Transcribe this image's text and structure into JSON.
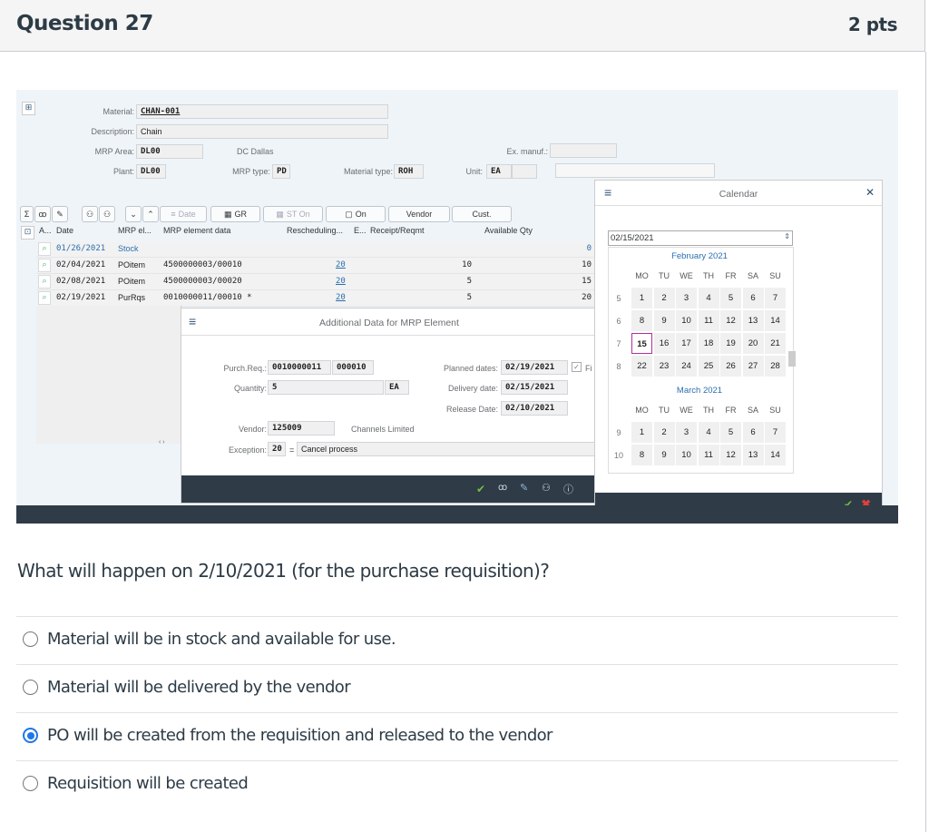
{
  "question": {
    "title": "Question 27",
    "points": "2 pts",
    "text": "What will happen on 2/10/2021 (for the purchase requisition)?",
    "answers": [
      {
        "label": "Material will be in stock and available for use.",
        "selected": false
      },
      {
        "label": "Material will be delivered by the vendor",
        "selected": false
      },
      {
        "label": "PO will be created from the requisition and released to the vendor",
        "selected": true
      },
      {
        "label": "Requisition will be created",
        "selected": false
      }
    ]
  },
  "sap": {
    "header": {
      "material_label": "Material:",
      "material": "CHAN-001",
      "description_label": "Description:",
      "description": "Chain",
      "mrp_area_label": "MRP Area:",
      "mrp_area": "DL00",
      "mrp_area_text": "DC Dallas",
      "plant_label": "Plant:",
      "plant": "DL00",
      "mrp_type_label": "MRP type:",
      "mrp_type": "PD",
      "material_type_label": "Material type:",
      "material_type": "ROH",
      "unit_label": "Unit:",
      "unit": "EA",
      "ex_manuf_label": "Ex. manuf.:"
    },
    "toolbar": {
      "date": "Date",
      "gr": "GR",
      "st_on": "ST On",
      "on": "On",
      "vendor": "Vendor",
      "cust": "Cust."
    },
    "columns": [
      "A...",
      "Date",
      "MRP el...",
      "MRP element data",
      "Rescheduling...",
      "E...",
      "Receipt/Reqmt",
      "Available Qty"
    ],
    "rows": [
      {
        "date": "01/26/2021",
        "el": "Stock",
        "data": "",
        "resched": "",
        "recv": "",
        "avail": "0"
      },
      {
        "date": "02/04/2021",
        "el": "POitem",
        "data": "4500000003/00010",
        "resched": "20",
        "recv": "10",
        "avail": "10"
      },
      {
        "date": "02/08/2021",
        "el": "POitem",
        "data": "4500000003/00020",
        "resched": "20",
        "recv": "5",
        "avail": "15"
      },
      {
        "date": "02/19/2021",
        "el": "PurRqs",
        "data": "0010000011/00010 *",
        "resched": "20",
        "recv": "5",
        "avail": "20"
      }
    ],
    "dialog": {
      "title": "Additional Data for MRP Element",
      "purch_req_label": "Purch.Req.:",
      "purch_req": "0010000011",
      "purch_req_item": "000010",
      "quantity_label": "Quantity:",
      "quantity": "5",
      "quantity_unit": "EA",
      "planned_dates_label": "Planned dates:",
      "planned_dates": "02/19/2021",
      "fix_label": "Fi",
      "delivery_date_label": "Delivery date:",
      "delivery_date": "02/15/2021",
      "release_date_label": "Release Date:",
      "release_date": "02/10/2021",
      "vendor_label": "Vendor:",
      "vendor": "125009",
      "vendor_name": "Channels Limited",
      "exception_label": "Exception:",
      "exception": "20",
      "exception_eq": "=",
      "exception_text": "Cancel process"
    },
    "calendar": {
      "title": "Calendar",
      "date_input": "02/15/2021",
      "months": [
        {
          "name": "February 2021",
          "weeks": [
            {
              "wk": "5",
              "days": [
                "1",
                "2",
                "3",
                "4",
                "5",
                "6",
                "7"
              ]
            },
            {
              "wk": "6",
              "days": [
                "8",
                "9",
                "10",
                "11",
                "12",
                "13",
                "14"
              ]
            },
            {
              "wk": "7",
              "days": [
                "15",
                "16",
                "17",
                "18",
                "19",
                "20",
                "21"
              ]
            },
            {
              "wk": "8",
              "days": [
                "22",
                "23",
                "24",
                "25",
                "26",
                "27",
                "28"
              ]
            }
          ]
        },
        {
          "name": "March 2021",
          "weeks": [
            {
              "wk": "9",
              "days": [
                "1",
                "2",
                "3",
                "4",
                "5",
                "6",
                "7"
              ]
            },
            {
              "wk": "10",
              "days": [
                "8",
                "9",
                "10",
                "11",
                "12",
                "13",
                "14"
              ]
            }
          ]
        }
      ],
      "weekdays": [
        "MO",
        "TU",
        "WE",
        "TH",
        "FR",
        "SA",
        "SU"
      ],
      "selected_day": "15"
    }
  }
}
